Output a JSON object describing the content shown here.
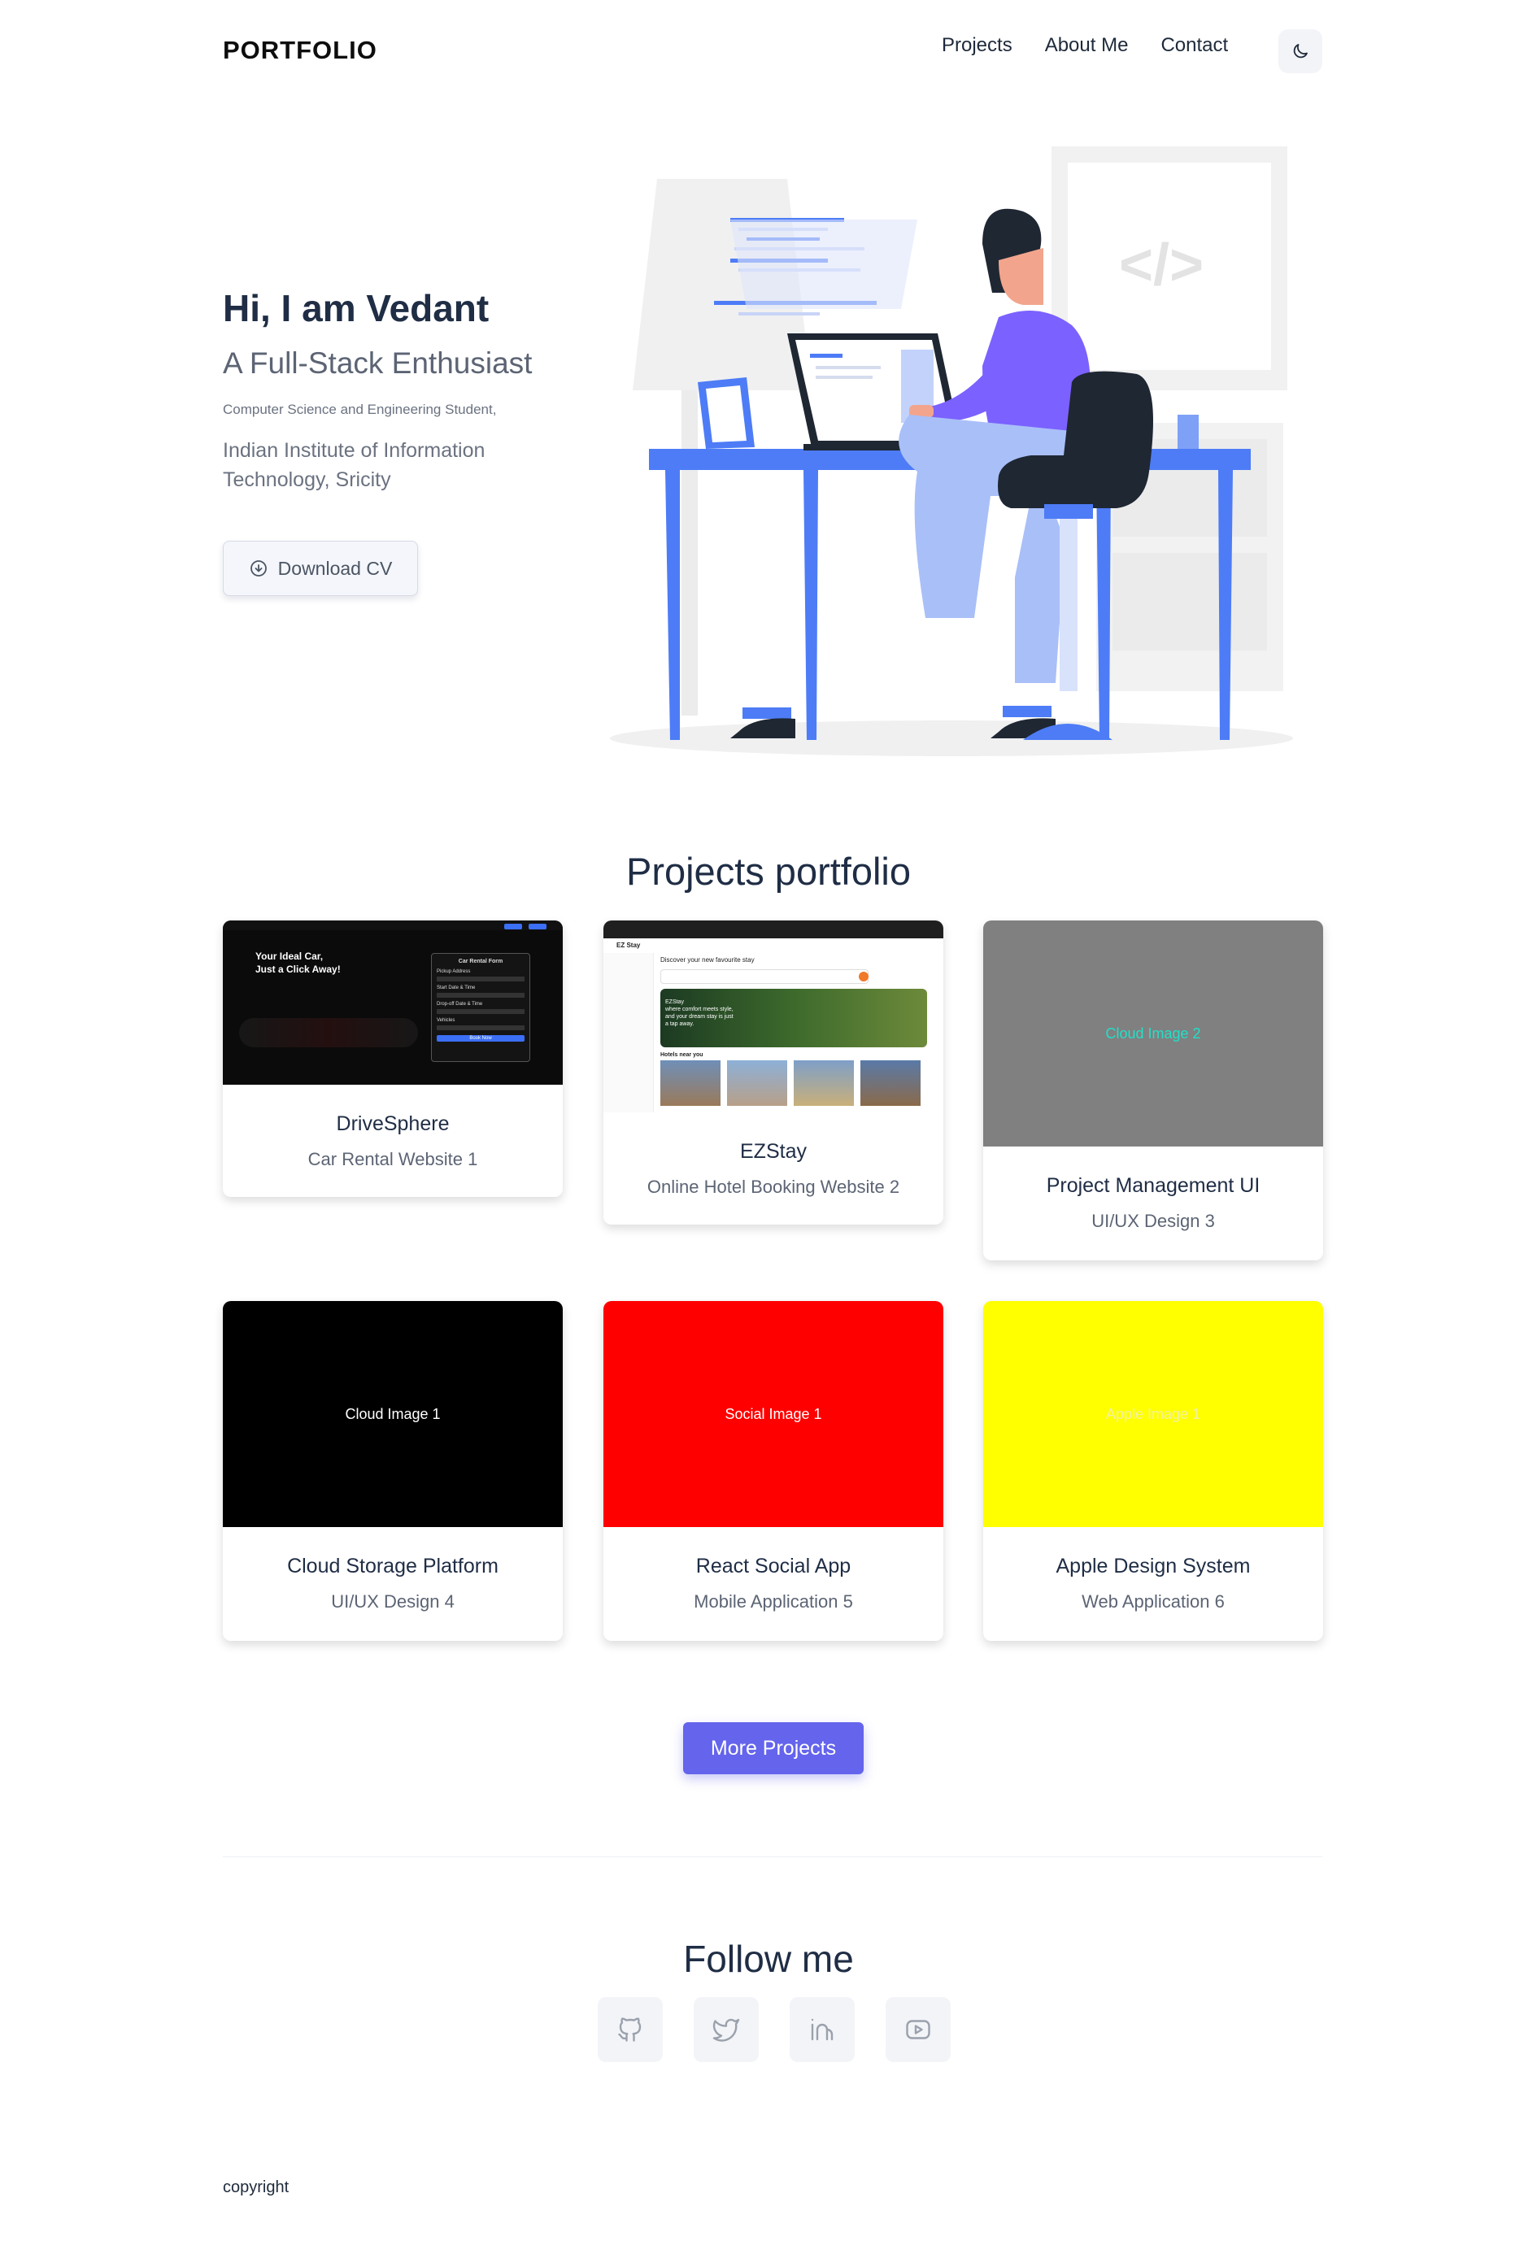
{
  "header": {
    "brand": "PORTFOLIO",
    "nav": [
      "Projects",
      "About Me",
      "Contact"
    ],
    "theme_icon": "moon-icon"
  },
  "hero": {
    "greeting": "Hi, I am Vedant",
    "role": "A Full-Stack Enthusiast",
    "subtitle": "Computer Science and Engineering Student,",
    "institution": "Indian Institute of Information Technology, Sricity",
    "cv_button": "Download CV",
    "cv_icon": "download-circle-icon",
    "illustration_code_symbol": "</>"
  },
  "projects": {
    "title": "Projects portfolio",
    "cards": [
      {
        "title": "DriveSphere",
        "subtitle": "Car Rental Website 1",
        "image_label": "",
        "image_color": "#0b0b0b",
        "screenshot": {
          "headline_line1": "Your Ideal Car,",
          "headline_line2": "Just a Click Away!",
          "form_title": "Car Rental Form",
          "form_fields": [
            "Pickup Address",
            "Start Date & Time",
            "Drop-off Date & Time",
            "Vehicles"
          ],
          "form_button": "Book Now"
        }
      },
      {
        "title": "EZStay",
        "subtitle": "Online Hotel Booking Website 2",
        "image_label": "",
        "image_color": "#ffffff",
        "screenshot": {
          "brand": "EZ Stay",
          "headline": "Discover your new favourite stay",
          "banner_line1": "EZStay",
          "banner_line2": "where comfort meets style,",
          "banner_line3": "and your dream stay is just",
          "banner_line4": "a tap away.",
          "section": "Hotels near you"
        }
      },
      {
        "title": "Project Management UI",
        "subtitle": "UI/UX Design 3",
        "image_label": "Cloud Image 2",
        "image_color": "#808080",
        "label_color": "#22e0c8"
      },
      {
        "title": "Cloud Storage Platform",
        "subtitle": "UI/UX Design 4",
        "image_label": "Cloud Image 1",
        "image_color": "#000000",
        "label_color": "#ffffff"
      },
      {
        "title": "React Social App",
        "subtitle": "Mobile Application 5",
        "image_label": "Social Image 1",
        "image_color": "#ff0000",
        "label_color": "#ffffff"
      },
      {
        "title": "Apple Design System",
        "subtitle": "Web Application 6",
        "image_label": "Apple Image 1",
        "image_color": "#ffff00",
        "label_color": "#f2f2a0"
      }
    ],
    "more_button": "More Projects"
  },
  "follow": {
    "title": "Follow me",
    "icons": [
      "github-icon",
      "twitter-icon",
      "linkedin-icon",
      "youtube-icon"
    ]
  },
  "footer": {
    "copyright": "copyright"
  },
  "colors": {
    "accent": "#6464ec",
    "illustration_blue": "#4d7cf6",
    "illustration_purple": "#7b61ff"
  }
}
